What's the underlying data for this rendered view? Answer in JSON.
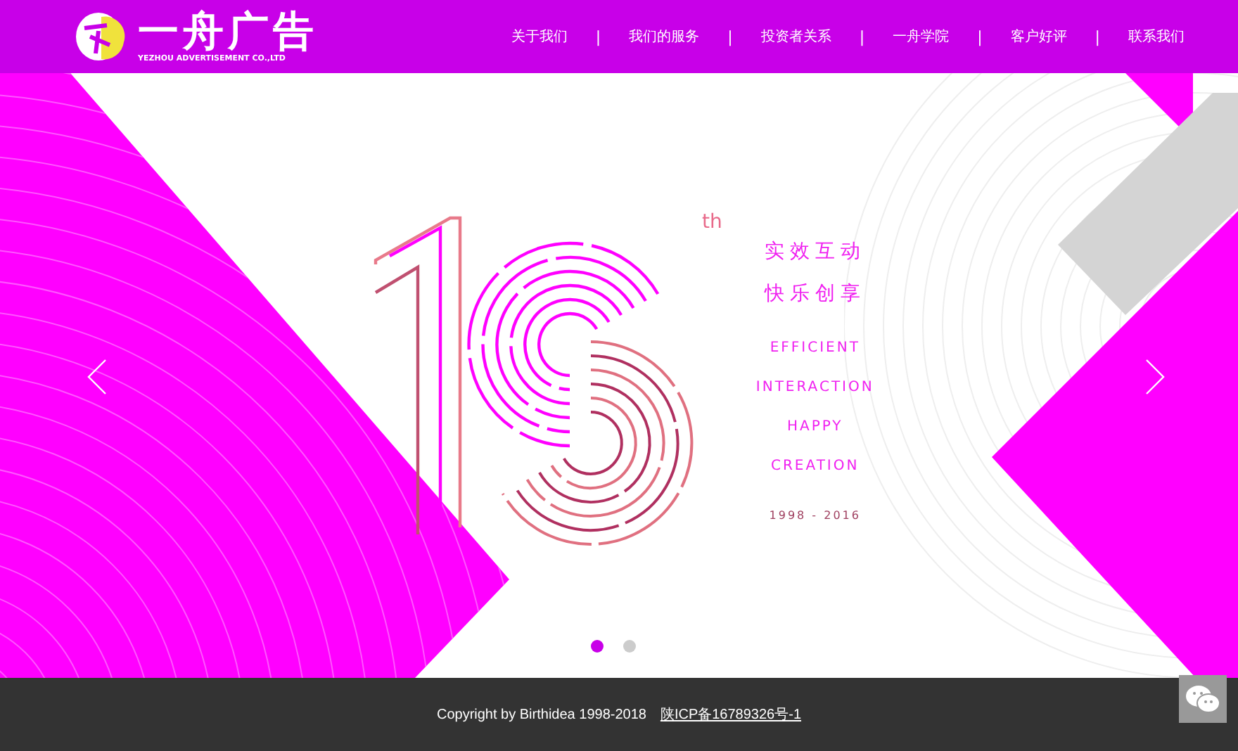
{
  "header": {
    "logo_title": "一舟广告",
    "logo_subtitle": "YEZHOU ADVERTISEMENT CO.,LTD",
    "nav": [
      {
        "label": "关于我们"
      },
      {
        "label": "我们的服务"
      },
      {
        "label": "投资者关系"
      },
      {
        "label": "一舟学院"
      },
      {
        "label": "客户好评"
      },
      {
        "label": "联系我们"
      }
    ],
    "separator": "|"
  },
  "banner": {
    "superscript": "th",
    "slogan": [
      "实效互动",
      "快乐创享"
    ],
    "english": [
      "EFFICIENT",
      "INTERACTION",
      "HAPPY",
      "CREATION"
    ],
    "years": "1998 - 2016",
    "dots": [
      {
        "selected": true
      },
      {
        "selected": false
      }
    ]
  },
  "footer": {
    "copyright": "Copyright by Birthidea 1998-2018",
    "icp_link": "陕ICP备16789326号-1"
  }
}
